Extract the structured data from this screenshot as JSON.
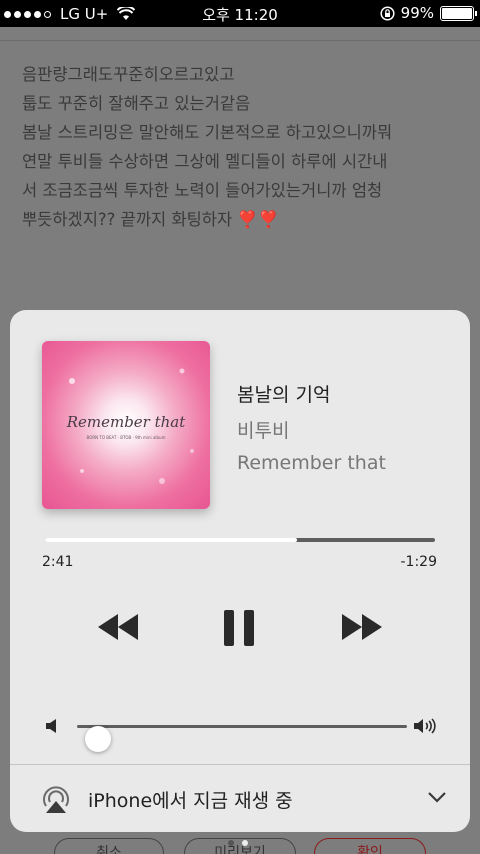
{
  "status_bar": {
    "carrier": "LG U+",
    "time": "오후 11:20",
    "battery": "99%",
    "signal_bars_filled": 4,
    "signal_bars_total": 5
  },
  "note": {
    "lines": [
      "음판량그래도꾸준히오르고있고",
      "툽도 꾸준히 잘해주고 있는거같음",
      "봄날 스트리밍은 말안해도 기본적으로 하고있으니까뭐",
      "연말 투비들 수상하면 그상에 멜디들이 하루에 시간내",
      "서 조금조금씩 투자한 노력이 들어가있는거니까 엄청",
      "뿌듯하겠지?? 끝까지 화팅하자"
    ],
    "emoji": "❣️❣️"
  },
  "background_buttons": {
    "left": "취소",
    "middle": "미리보기",
    "right": "확인"
  },
  "now_playing": {
    "song_title": "봄날의 기억",
    "artist": "비투비",
    "album": "Remember that",
    "album_art_text": "Remember that",
    "album_art_subtext": "BORN TO BEAT · BTOB · 9th mini album",
    "elapsed": "2:41",
    "remaining": "-1:29",
    "progress": 0.645,
    "volume": 0.04,
    "output_label": "iPhone에서 지금 재생 중"
  },
  "colors": {
    "sheet_bg": "#e9e9e9",
    "dim_bg": "#7d7d7d",
    "art_pink": "#ee6fa0"
  }
}
